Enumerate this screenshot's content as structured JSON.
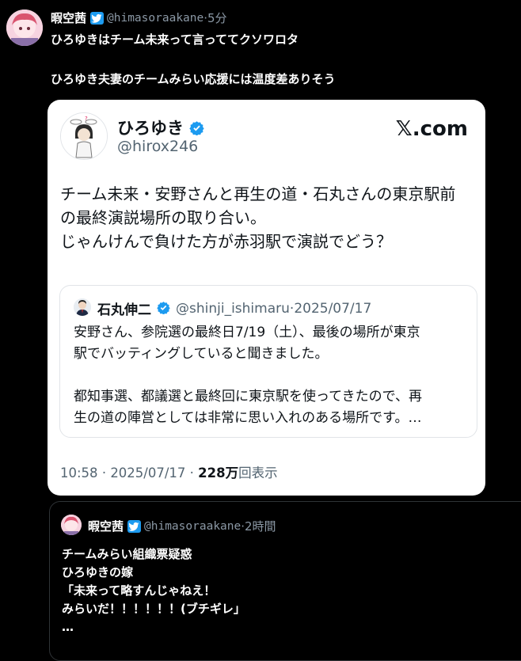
{
  "post": {
    "display_name": "暇空茜",
    "handle": "@himasoraakane",
    "separator": "·",
    "time": "5分",
    "lines": [
      "ひろゆきはチーム未来って言っててクソワロタ",
      "ひろゆき夫妻のチームみらい応援には温度差ありそう"
    ]
  },
  "embedded_tweet": {
    "display_name": "ひろゆき",
    "handle": "@hirox246",
    "site_logo": "𝕏.com",
    "lines": [
      "チーム未来・安野さんと再生の道・石丸さんの東京駅前",
      "の最終演説場所の取り合い。",
      "じゃんけんで負けた方が赤羽駅で演説でどう？"
    ],
    "quote": {
      "display_name": "石丸伸二",
      "handle": "@shinji_ishimaru",
      "separator": "·",
      "date": "2025/07/17",
      "lines": [
        "安野さん、参院選の最終日7/19（土）、最後の場所が東京",
        "駅でバッティングしていると聞きました。",
        "都知事選、都議選と最終回に東京駅を使ってきたので、再",
        "生の道の陣営としては非常に思い入れのある場所です。…"
      ]
    },
    "meta": {
      "time": "10:58",
      "separator": "·",
      "date": "2025/07/17",
      "separator2": "·",
      "views": "228万",
      "views_label": "回表示"
    }
  },
  "reply": {
    "display_name": "暇空茜",
    "handle": "@himasoraakane",
    "separator": "·",
    "time": "2時間",
    "lines": [
      "チームみらい組織票疑惑",
      "ひろゆきの嫁",
      "「未来って略すんじゃねえ！",
      "みらいだ！！！！！！(ブチギレ」",
      "…"
    ]
  },
  "colors": {
    "verified": "#1d9bf0",
    "background": "#000000",
    "card": "#ffffff"
  },
  "icons": {
    "verified_badge": "twitter-bird-badge-icon",
    "round_check": "verified-check-icon"
  }
}
